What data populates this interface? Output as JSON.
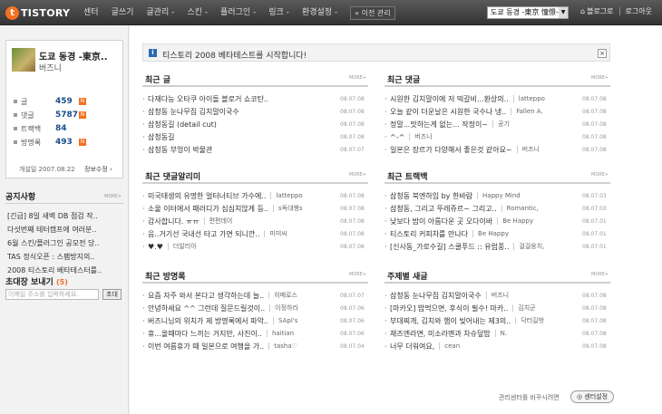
{
  "topbar": {
    "logo_letter": "t",
    "logo_text": "TISTORY",
    "nav": [
      "센터",
      "글쓰기",
      "글관리 -",
      "스킨 -",
      "플러그인 -",
      "링크 -",
      "환경설정 -"
    ],
    "prev_admin": "« 이전 관리",
    "blog_select": "도쿄 동경 -東京 憧憬-",
    "blog_link": "블로그로",
    "logout": "로그아웃"
  },
  "profile": {
    "blog_name": "도쿄 동경 -東京..",
    "owner": "버즈니",
    "stats": [
      {
        "label": "글",
        "value": "459",
        "new": true
      },
      {
        "label": "댓글",
        "value": "5787",
        "new": true
      },
      {
        "label": "트랙백",
        "value": "84",
        "new": false
      },
      {
        "label": "방명록",
        "value": "493",
        "new": true
      }
    ],
    "new_badge": "N",
    "open_date": "개설일 2007.08.22",
    "info_edit": "정보수정 ›"
  },
  "sidebar": {
    "more_label": "MORE+",
    "notice_title": "공지사항",
    "notices": [
      "[긴급] 8일 새벽 DB 점검 작..",
      "다섯번째 테터캠프에 여러분..",
      "6월 스킨/플러그인 공모전 당..",
      "TAS 정식오픈 : 스팸방지의..",
      "2008 티스토리 베타테스터를.."
    ],
    "invite_title": "초대장 보내기",
    "invite_count": "(5)",
    "invite_placeholder": "이메일 주소를 입력하세요.",
    "invite_button": "초대"
  },
  "main": {
    "notice_icon": "i",
    "notice_text": "티스토리 2008 베타테스트를 시작합니다!",
    "close_icon": "×",
    "more_label": "MORE+",
    "panels": [
      {
        "title": "최근 글",
        "rows": [
          {
            "title": "다재다능 오타쿠 아이돌 블로거 쇼코탄..",
            "author": "",
            "date": "08.07.08"
          },
          {
            "title": "삼청동 눈나무집 김치말이국수",
            "author": "",
            "date": "08.07.08"
          },
          {
            "title": "삼청동길 (detail cut)",
            "author": "",
            "date": "08.07.08"
          },
          {
            "title": "삼청동길",
            "author": "",
            "date": "08.07.08"
          },
          {
            "title": "삼청동 부엉이 박물관",
            "author": "",
            "date": "08.07.07"
          }
        ]
      },
      {
        "title": "최근 댓글",
        "rows": [
          {
            "title": "시원한 김치말이에 저 떡갈비...환상의..",
            "author": "latteppo",
            "date": "08.07.08"
          },
          {
            "title": "오늘 같이 더운날은 시원한 국수나 냉..",
            "author": "Fallen A.",
            "date": "08.07.08"
          },
          {
            "title": "정말...맛하는게 없는... 작정이~",
            "author": "공기",
            "date": "08.07.08"
          },
          {
            "title": "^-^",
            "author": "버즈니",
            "date": "08.07.08"
          },
          {
            "title": "일본은 장르가 다양해서 좋은것 같아요~",
            "author": "버즈니",
            "date": "08.07.08"
          }
        ]
      },
      {
        "title": "최근 댓글알리미",
        "rows": [
          {
            "title": "미국태생의 유명한 얼터너티브 가수에..",
            "author": "latteppo",
            "date": "08.07.08"
          },
          {
            "title": "소울 이터에서 패러디가 심심치않게 등..",
            "author": "s독대행s",
            "date": "08.07.08"
          },
          {
            "title": "감사합니다. ㅠㅠ",
            "author": "편편데이",
            "date": "08.07.08"
          },
          {
            "title": "음..거기선 국내선 타고 가면 되니깐..",
            "author": "미미씨",
            "date": "08.07.08"
          },
          {
            "title": "♥.♥",
            "author": "더알리아",
            "date": "08.07.08"
          }
        ]
      },
      {
        "title": "최근 트랙백",
        "rows": [
          {
            "title": "삼청동 북엔하임 by 한바람",
            "author": "Happy Mind",
            "date": "08.07.03"
          },
          {
            "title": "삼청동, 그리고 뚜레쥬르~ 그리고..",
            "author": "Romantic,",
            "date": "08.07.03"
          },
          {
            "title": "낮보다 밤이 아름다운 곳 오다이바",
            "author": "Be Happy",
            "date": "08.07.01"
          },
          {
            "title": "티스토리 커피차를 만나다",
            "author": "Be Happy",
            "date": "08.07.01"
          },
          {
            "title": "[신사동_가로수길] 스쿨푸드 :: 유럽풍..",
            "author": "걸걸웅치,",
            "date": "08.07.01"
          }
        ]
      },
      {
        "title": "최근 방명록",
        "rows": [
          {
            "title": "요즘 자주 와서 본다고 생각하는데 늘..",
            "author": "히메로스",
            "date": "08.07.07"
          },
          {
            "title": "안녕하세요 ^^ 그런데 질문드릴것이..",
            "author": "이정하라",
            "date": "08.07.06"
          },
          {
            "title": "버즈니님의 위치가 제 방명록에서 파악..",
            "author": "SApi's",
            "date": "08.07.06"
          },
          {
            "title": "휴...올때마다 느끼는 거지만, 사진이..",
            "author": "haitian",
            "date": "08.07.06"
          },
          {
            "title": "이번 여름휴가 때 일본으로 여행을 가..",
            "author": "tasha♡",
            "date": "08.07.04"
          }
        ]
      },
      {
        "title": "주제별 새글",
        "rows": [
          {
            "title": "삼청동 눈나무집 김치말이국수",
            "author": "버즈니",
            "date": "08.07.08"
          },
          {
            "title": "[마카오] 밥먹으면, 후식이 필수! 마카..",
            "author": "김치군",
            "date": "08.07.08"
          },
          {
            "title": "부대찌개, 김치와 햄이 빚어내는 제3의..",
            "author": "닥터길벗",
            "date": "08.07.08"
          },
          {
            "title": "재즈엔라면, 미소라멘과 차슈덮밥",
            "author": "N.",
            "date": "08.07.08"
          },
          {
            "title": "너무 더워여요,",
            "author": "cean",
            "date": "08.07.08"
          }
        ]
      }
    ],
    "footer_text": "관리센터를 바꾸시려면",
    "footer_button": "◎ 센터설정"
  }
}
